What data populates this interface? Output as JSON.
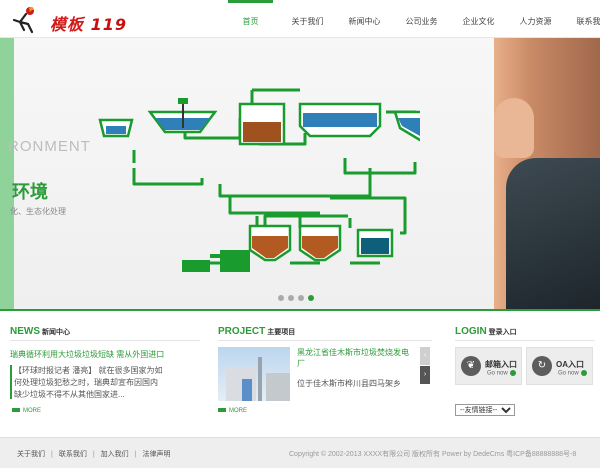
{
  "brand": {
    "name": "模板",
    "number": "119"
  },
  "nav": [
    {
      "label": "首页",
      "active": true
    },
    {
      "label": "关于我们",
      "active": false
    },
    {
      "label": "新闻中心",
      "active": false
    },
    {
      "label": "公司业务",
      "active": false
    },
    {
      "label": "企业文化",
      "active": false
    },
    {
      "label": "人力资源",
      "active": false
    },
    {
      "label": "联系我们",
      "active": false
    }
  ],
  "banner": {
    "eng_text": "RONMENT",
    "cn_title": "环境",
    "cn_sub": "化、生态化处理",
    "slides": 4,
    "active_slide": 3
  },
  "news": {
    "title_en": "NEWS",
    "title_cn": "新闻中心",
    "headline": "瑞典循环利用大垃圾垃圾短缺 需从外国进口",
    "summary": "【环球时报记者 潘亮】 就在很多国家为如何处理垃圾犯愁之时，瑞典却宣布因国内缺少垃圾不得不从其他国家进...",
    "more": "MORE"
  },
  "project": {
    "title_en": "PROJECT",
    "title_cn": "主要项目",
    "name": "黑龙江省佳木斯市垃圾焚烧发电厂",
    "desc": "位于佳木斯市桦川县四马架乡",
    "more": "MORE",
    "prev": "‹",
    "next": "›"
  },
  "login": {
    "title_en": "LOGIN",
    "title_cn": "登录入口",
    "mail": {
      "label": "邮箱入口",
      "sub": "Go now",
      "icon": "leaf-icon"
    },
    "oa": {
      "label": "OA入口",
      "sub": "Go now",
      "icon": "refresh-icon"
    },
    "links_default": "--友情链接--"
  },
  "footer": {
    "links": [
      "关于我们",
      "联系我们",
      "加入我们",
      "法律声明"
    ],
    "copyright": "Copyright © 2002-2013 XXXX有限公司 版权所有   Power by DedeCms   粤ICP备88888888号-8"
  },
  "colors": {
    "accent": "#2c9b39",
    "logo_red": "#d11b1b"
  }
}
